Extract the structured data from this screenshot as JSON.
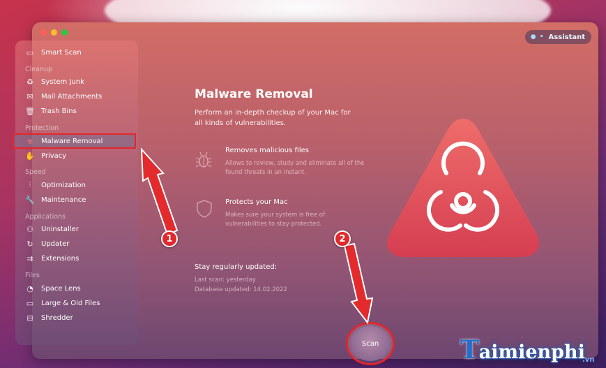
{
  "assistant": {
    "label": "Assistant",
    "prefix": "● •"
  },
  "sidebar": {
    "items": [
      {
        "label": "Smart Scan",
        "icon": "monitor-scan-icon"
      },
      {
        "label": "System Junk",
        "icon": "recycle-icon"
      },
      {
        "label": "Mail Attachments",
        "icon": "envelope-icon"
      },
      {
        "label": "Trash Bins",
        "icon": "trash-icon"
      },
      {
        "label": "Malware Removal",
        "icon": "biohazard-icon"
      },
      {
        "label": "Privacy",
        "icon": "hand-icon"
      },
      {
        "label": "Optimization",
        "icon": "sliders-icon"
      },
      {
        "label": "Maintenance",
        "icon": "wrench-icon"
      },
      {
        "label": "Uninstaller",
        "icon": "uninstall-icon"
      },
      {
        "label": "Updater",
        "icon": "update-icon"
      },
      {
        "label": "Extensions",
        "icon": "extensions-icon"
      },
      {
        "label": "Space Lens",
        "icon": "lens-icon"
      },
      {
        "label": "Large & Old Files",
        "icon": "folder-icon"
      },
      {
        "label": "Shredder",
        "icon": "shredder-icon"
      }
    ],
    "sections": [
      "Cleanup",
      "Protection",
      "Speed",
      "Applications",
      "Files"
    ]
  },
  "main": {
    "title": "Malware Removal",
    "description": "Perform an in-depth checkup of your Mac for all kinds of vulnerabilities.",
    "features": [
      {
        "title": "Removes malicious files",
        "desc_lines": [
          "Allows to review, study and eliminate all of the",
          "found threats in an instant."
        ]
      },
      {
        "title": "Protects your Mac",
        "desc_lines": [
          "Makes sure your system is free of",
          "vulnerabilities to stay protected."
        ]
      }
    ],
    "update": {
      "title": "Stay regularly updated:",
      "last_scan": "Last scan: yesterday",
      "db_updated": "Database updated: 14.02.2022"
    },
    "scan_label": "Scan"
  },
  "callouts": [
    "1",
    "2"
  ],
  "watermark": {
    "initial": "T",
    "text": "aimienphi",
    "suffix": ".vn"
  },
  "colors": {
    "highlight_red": "#e2262b",
    "hazard_red": "#e4515a"
  }
}
